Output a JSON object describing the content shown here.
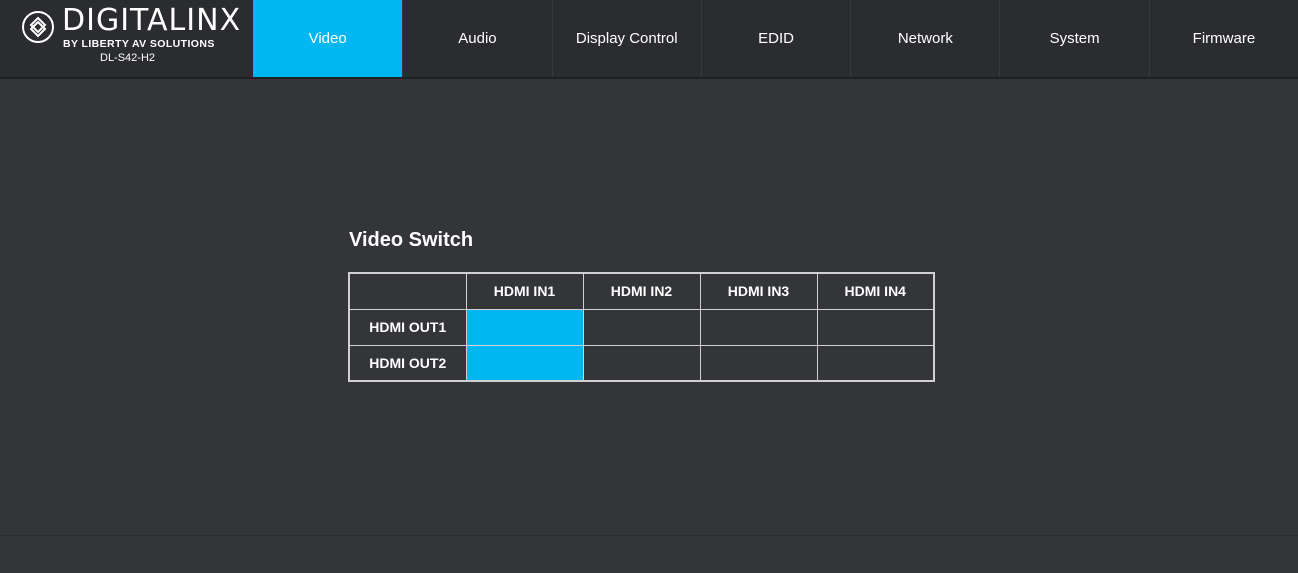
{
  "brand": {
    "name": "DIGITALINX",
    "subtitle": "BY LIBERTY AV SOLUTIONS",
    "model": "DL-S42-H2",
    "icon": "digitalinx-logo-icon"
  },
  "nav": {
    "tabs": [
      {
        "label": "Video",
        "active": true
      },
      {
        "label": "Audio",
        "active": false
      },
      {
        "label": "Display Control",
        "active": false
      },
      {
        "label": "EDID",
        "active": false
      },
      {
        "label": "Network",
        "active": false
      },
      {
        "label": "System",
        "active": false
      },
      {
        "label": "Firmware",
        "active": false
      }
    ]
  },
  "video_switch": {
    "title": "Video Switch",
    "inputs": [
      "HDMI IN1",
      "HDMI IN2",
      "HDMI IN3",
      "HDMI IN4"
    ],
    "outputs": [
      {
        "label": "HDMI OUT1",
        "selected_input": "HDMI IN1"
      },
      {
        "label": "HDMI OUT2",
        "selected_input": "HDMI IN1"
      }
    ]
  },
  "colors": {
    "accent": "#00b7f1",
    "background": "#333539",
    "navbar": "#2b2c30"
  }
}
